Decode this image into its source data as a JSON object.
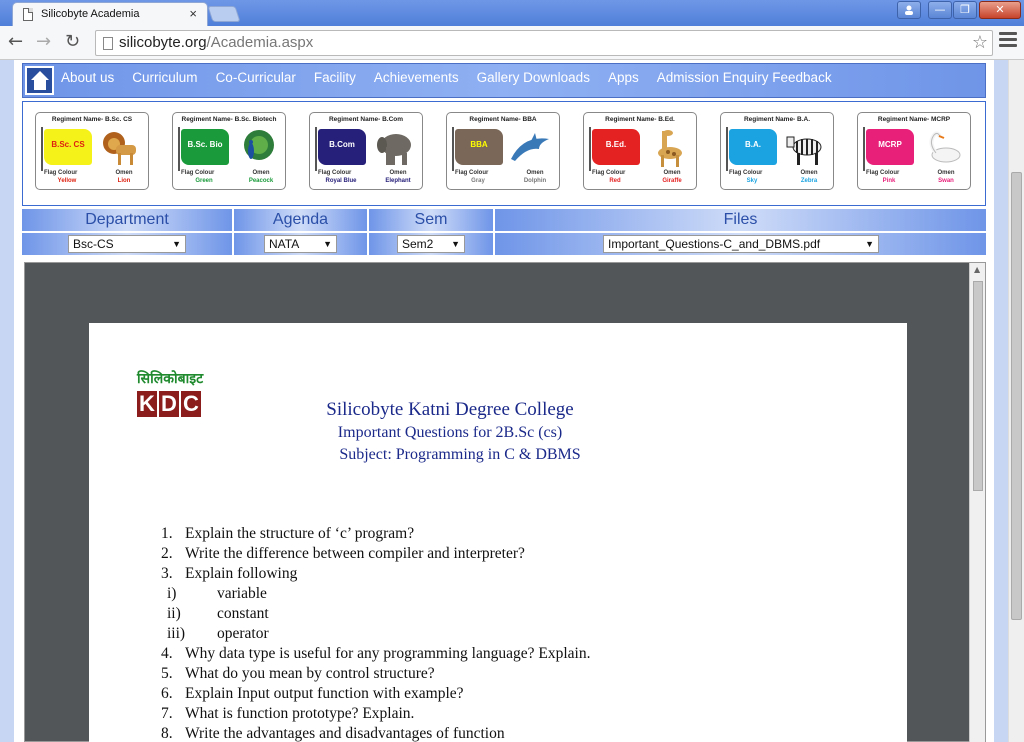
{
  "browser": {
    "tab_title": "Silicobyte Academia",
    "tab_close": "×",
    "url_host": "silicobyte.org",
    "url_path": "/Academia.aspx",
    "win_min": "—",
    "win_max": "❐",
    "win_close": "✕",
    "user_icon": "person-icon"
  },
  "menu": {
    "items": [
      "About us",
      "Curriculum",
      "Co-Curricular",
      "Facility",
      "Achievements",
      "Gallery Downloads",
      "Apps",
      "Admission Enquiry Feedback"
    ]
  },
  "regiments": [
    {
      "name": "Regiment Name- B.Sc. CS",
      "flag_text": "B.Sc. CS",
      "flag_color": "#f5f21a",
      "flag_text_color": "#d21",
      "flag_colour_label": "Flag Colour",
      "flag_colour": "Yellow",
      "omen_label": "Omen",
      "omen": "Lion",
      "value_color": "#d21"
    },
    {
      "name": "Regiment Name- B.Sc. Biotech",
      "flag_text": "B.Sc. Bio",
      "flag_color": "#1a9a3a",
      "flag_text_color": "#fff",
      "flag_colour_label": "Flag Colour",
      "flag_colour": "Green",
      "omen_label": "Omen",
      "omen": "Peacock",
      "value_color": "#1a9a3a"
    },
    {
      "name": "Regiment Name- B.Com",
      "flag_text": "B.Com",
      "flag_color": "#27207a",
      "flag_text_color": "#fff",
      "flag_colour_label": "Flag Colour",
      "flag_colour": "Royal Blue",
      "omen_label": "Omen",
      "omen": "Elephant",
      "value_color": "#27207a"
    },
    {
      "name": "Regiment Name- BBA",
      "flag_text": "BBA",
      "flag_color": "#7a6758",
      "flag_text_color": "#ff0",
      "flag_colour_label": "Flag Colour",
      "flag_colour": "Gray",
      "omen_label": "Omen",
      "omen": "Dolphin",
      "value_color": "#777"
    },
    {
      "name": "Regiment Name- B.Ed.",
      "flag_text": "B.Ed.",
      "flag_color": "#e52222",
      "flag_text_color": "#fff",
      "flag_colour_label": "Flag Colour",
      "flag_colour": "Red",
      "omen_label": "Omen",
      "omen": "Giraffe",
      "value_color": "#e52222"
    },
    {
      "name": "Regiment Name- B.A.",
      "flag_text": "B.A.",
      "flag_color": "#1aa3e0",
      "flag_text_color": "#fff",
      "flag_colour_label": "Flag Colour",
      "flag_colour": "Sky",
      "omen_label": "Omen",
      "omen": "Zebra",
      "value_color": "#1aa3e0"
    },
    {
      "name": "Regiment Name- MCRP",
      "flag_text": "MCRP",
      "flag_color": "#e8207a",
      "flag_text_color": "#fff",
      "flag_colour_label": "Flag Colour",
      "flag_colour": "Pink",
      "omen_label": "Omen",
      "omen": "Swan",
      "value_color": "#e8207a"
    }
  ],
  "filters": {
    "department": {
      "label": "Department",
      "value": "Bsc-CS"
    },
    "agenda": {
      "label": "Agenda",
      "value": "NATA"
    },
    "sem": {
      "label": "Sem",
      "value": "Sem2"
    },
    "files": {
      "label": "Files",
      "value": "Important_Questions-C_and_DBMS.pdf"
    }
  },
  "document": {
    "logo_hindi": "सिलिकोबाइट",
    "logo_letters": [
      "K",
      "D",
      "C"
    ],
    "title": "Silicobyte Katni Degree College",
    "subtitle1": "Important Questions for 2B.Sc (cs)",
    "subtitle2": "Subject: Programming in C & DBMS",
    "questions": [
      {
        "num": "1.",
        "text": "Explain the structure of ‘c’ program?"
      },
      {
        "num": "2.",
        "text": "Write the difference between compiler and interpreter?"
      },
      {
        "num": "3.",
        "text": "Explain following"
      },
      {
        "num": "i)",
        "text": "variable",
        "sub": true
      },
      {
        "num": "ii)",
        "text": "constant",
        "sub": true
      },
      {
        "num": "iii)",
        "text": "operator",
        "sub": true
      },
      {
        "num": "4.",
        "text": "Why data type is useful for any programming language? Explain."
      },
      {
        "num": "5.",
        "text": "What do you mean by control structure?"
      },
      {
        "num": "6.",
        "text": "Explain Input output function with example?"
      },
      {
        "num": "7.",
        "text": "What is function prototype? Explain."
      },
      {
        "num": "8.",
        "text": "Write the advantages and disadvantages of function"
      }
    ]
  }
}
